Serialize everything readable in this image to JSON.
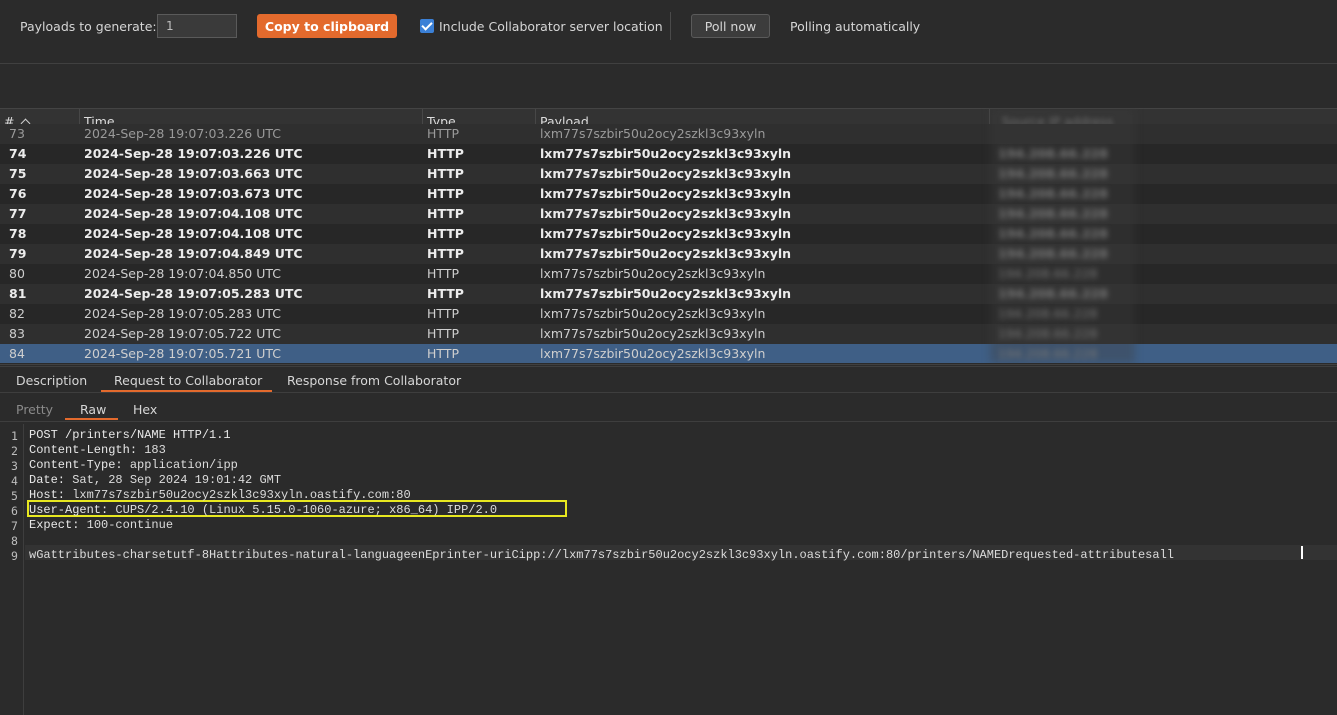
{
  "toolbar": {
    "payloads_label": "Payloads to generate:",
    "payloads_value": "1",
    "copy_label": "Copy to clipboard",
    "include_label": "Include Collaborator server location",
    "include_checked": true,
    "poll_label": "Poll now",
    "polling_status": "Polling automatically"
  },
  "table": {
    "columns": [
      "#",
      "Time",
      "Type",
      "Payload",
      "Source IP address"
    ],
    "partial_row": {
      "num": "73",
      "time": "2024-Sep-28 19:07:03.226 UTC",
      "type": "HTTP",
      "payload": "lxm77s7szbir50u2ocy2szkl3c93xyln"
    },
    "rows": [
      {
        "num": "74",
        "time": "2024-Sep-28 19:07:03.226 UTC",
        "type": "HTTP",
        "payload": "lxm77s7szbir50u2ocy2szkl3c93xyln",
        "ip": "194.208.66.228",
        "bold": true
      },
      {
        "num": "75",
        "time": "2024-Sep-28 19:07:03.663 UTC",
        "type": "HTTP",
        "payload": "lxm77s7szbir50u2ocy2szkl3c93xyln",
        "ip": "194.208.66.228",
        "bold": true
      },
      {
        "num": "76",
        "time": "2024-Sep-28 19:07:03.673 UTC",
        "type": "HTTP",
        "payload": "lxm77s7szbir50u2ocy2szkl3c93xyln",
        "ip": "194.208.66.228",
        "bold": true
      },
      {
        "num": "77",
        "time": "2024-Sep-28 19:07:04.108 UTC",
        "type": "HTTP",
        "payload": "lxm77s7szbir50u2ocy2szkl3c93xyln",
        "ip": "194.208.66.228",
        "bold": true
      },
      {
        "num": "78",
        "time": "2024-Sep-28 19:07:04.108 UTC",
        "type": "HTTP",
        "payload": "lxm77s7szbir50u2ocy2szkl3c93xyln",
        "ip": "194.208.66.228",
        "bold": true
      },
      {
        "num": "79",
        "time": "2024-Sep-28 19:07:04.849 UTC",
        "type": "HTTP",
        "payload": "lxm77s7szbir50u2ocy2szkl3c93xyln",
        "ip": "194.208.66.228",
        "bold": true
      },
      {
        "num": "80",
        "time": "2024-Sep-28 19:07:04.850 UTC",
        "type": "HTTP",
        "payload": "lxm77s7szbir50u2ocy2szkl3c93xyln",
        "ip": "194.208.66.228",
        "bold": false
      },
      {
        "num": "81",
        "time": "2024-Sep-28 19:07:05.283 UTC",
        "type": "HTTP",
        "payload": "lxm77s7szbir50u2ocy2szkl3c93xyln",
        "ip": "194.208.66.228",
        "bold": true
      },
      {
        "num": "82",
        "time": "2024-Sep-28 19:07:05.283 UTC",
        "type": "HTTP",
        "payload": "lxm77s7szbir50u2ocy2szkl3c93xyln",
        "ip": "194.208.66.228",
        "bold": false
      },
      {
        "num": "83",
        "time": "2024-Sep-28 19:07:05.722 UTC",
        "type": "HTTP",
        "payload": "lxm77s7szbir50u2ocy2szkl3c93xyln",
        "ip": "194.208.66.228",
        "bold": false
      },
      {
        "num": "84",
        "time": "2024-Sep-28 19:07:05.721 UTC",
        "type": "HTTP",
        "payload": "lxm77s7szbir50u2ocy2szkl3c93xyln",
        "ip": "194.208.66.228",
        "bold": false,
        "selected": true
      }
    ]
  },
  "detail_tabs": [
    "Description",
    "Request to Collaborator",
    "Response from Collaborator"
  ],
  "detail_active": 1,
  "view_tabs": [
    "Pretty",
    "Raw",
    "Hex"
  ],
  "view_active": 1,
  "editor": {
    "lines": [
      {
        "n": "1",
        "key": "POST /printers/NAME HTTP/1.1",
        "val": ""
      },
      {
        "n": "2",
        "key": "Content-Length:",
        "val": " 183"
      },
      {
        "n": "3",
        "key": "Content-Type:",
        "val": " application/ipp"
      },
      {
        "n": "4",
        "key": "Date:",
        "val": " Sat, 28 Sep 2024 19:01:42 GMT"
      },
      {
        "n": "5",
        "key": "Host:",
        "val": " lxm77s7szbir50u2ocy2szkl3c93xyln.oastify.com:80"
      },
      {
        "n": "6",
        "key": "User-Agent:",
        "val": " CUPS/2.4.10 (Linux 5.15.0-1060-azure; x86_64) IPP/2.0"
      },
      {
        "n": "7",
        "key": "Expect:",
        "val": " 100-continue"
      },
      {
        "n": "8",
        "key": "",
        "val": ""
      },
      {
        "n": "9",
        "key": "",
        "val": "wGattributes-charsetutf-8Hattributes-natural-languageenEprinter-uriCipp://lxm77s7szbir50u2ocy2szkl3c93xyln.oastify.com:80/printers/NAMEDrequested-attributesall"
      }
    ],
    "highlight_color": "#e8e820"
  },
  "colors": {
    "accent": "#e36a2d",
    "selection": "#3f5f86",
    "checkbox": "#3b80d6"
  }
}
